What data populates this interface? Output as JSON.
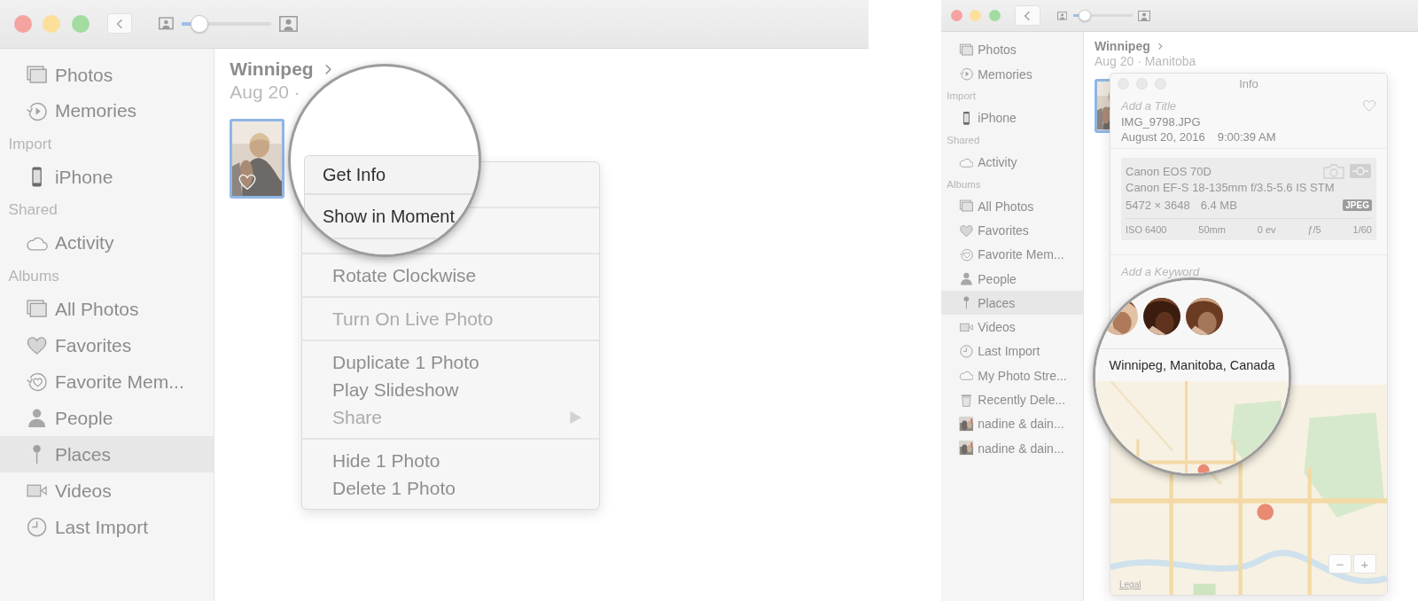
{
  "windows": [
    {
      "toolbar": {
        "zoom_slider": {
          "level": 0.2
        }
      },
      "sidebar": {
        "sections": [
          {
            "items": [
              {
                "label": "Photos",
                "kind": "photos",
                "selected": false
              },
              {
                "label": "Memories",
                "kind": "memories",
                "selected": false
              }
            ]
          },
          {
            "heading": "Import",
            "items": [
              {
                "label": "iPhone",
                "kind": "phone",
                "selected": false
              }
            ]
          },
          {
            "heading": "Shared",
            "items": [
              {
                "label": "Activity",
                "kind": "cloud",
                "selected": false
              }
            ]
          },
          {
            "heading": "Albums",
            "items": [
              {
                "label": "All Photos",
                "kind": "photos",
                "selected": false
              },
              {
                "label": "Favorites",
                "kind": "heart",
                "selected": false
              },
              {
                "label": "Favorite Mem...",
                "kind": "heart-memories",
                "selected": false
              },
              {
                "label": "People",
                "kind": "person",
                "selected": false
              },
              {
                "label": "Places",
                "kind": "pin",
                "selected": true
              },
              {
                "label": "Videos",
                "kind": "video",
                "selected": false
              },
              {
                "label": "Last Import",
                "kind": "clock",
                "selected": false
              }
            ]
          }
        ]
      },
      "content": {
        "title": "Winnipeg",
        "subtitle": "Aug 20 ·",
        "thumbnails": [
          {
            "kind": "picture",
            "selected": true,
            "favorite": true
          }
        ]
      },
      "context_menu": {
        "groups": [
          {
            "items": [
              {
                "label": "Rotate Clockwise",
                "disabled": false,
                "submenu": false
              }
            ]
          },
          {
            "items": [
              {
                "label": "Turn On Live Photo",
                "disabled": true,
                "submenu": false
              }
            ]
          },
          {
            "items": [
              {
                "label": "Duplicate 1 Photo",
                "disabled": false,
                "submenu": false
              },
              {
                "label": "Play Slideshow",
                "disabled": false,
                "submenu": false
              },
              {
                "label": "Share",
                "disabled": true,
                "submenu": true
              }
            ]
          },
          {
            "items": [
              {
                "label": "Hide 1 Photo",
                "disabled": false,
                "submenu": false
              },
              {
                "label": "Delete 1 Photo",
                "disabled": false,
                "submenu": false
              }
            ]
          }
        ]
      },
      "magnifier": {
        "kind": "menu",
        "items": [
          {
            "label": "Get Info"
          },
          {
            "label": "Show in Moment"
          }
        ]
      }
    },
    {
      "toolbar": {
        "zoom_slider": {
          "level": 0.2
        }
      },
      "sidebar": {
        "sections": [
          {
            "items": [
              {
                "label": "Photos",
                "kind": "photos",
                "selected": false
              },
              {
                "label": "Memories",
                "kind": "memories",
                "selected": false
              }
            ]
          },
          {
            "heading": "Import",
            "items": [
              {
                "label": "iPhone",
                "kind": "phone",
                "selected": false
              }
            ]
          },
          {
            "heading": "Shared",
            "items": [
              {
                "label": "Activity",
                "kind": "cloud",
                "selected": false
              }
            ]
          },
          {
            "heading": "Albums",
            "items": [
              {
                "label": "All Photos",
                "kind": "photos",
                "selected": false
              },
              {
                "label": "Favorites",
                "kind": "heart",
                "selected": false
              },
              {
                "label": "Favorite Mem...",
                "kind": "heart-memories",
                "selected": false
              },
              {
                "label": "People",
                "kind": "person",
                "selected": false
              },
              {
                "label": "Places",
                "kind": "pin",
                "selected": true
              },
              {
                "label": "Videos",
                "kind": "video",
                "selected": false
              },
              {
                "label": "Last Import",
                "kind": "clock",
                "selected": false
              },
              {
                "label": "My Photo Stre...",
                "kind": "cloud",
                "selected": false
              },
              {
                "label": "Recently Dele...",
                "kind": "trash",
                "selected": false
              },
              {
                "label": "nadine & dain...",
                "kind": "album",
                "selected": false
              },
              {
                "label": "nadine & dain...",
                "kind": "album",
                "selected": false
              }
            ]
          }
        ]
      },
      "content": {
        "title": "Winnipeg",
        "subtitle": "Aug 20 · Manitoba",
        "thumbnails": [
          {
            "kind": "picture",
            "selected": true,
            "favorite": false
          }
        ]
      },
      "info_panel": {
        "title": "Info",
        "title_placeholder": "Add a Title",
        "filename": "IMG_9798.JPG",
        "date": "August 20, 2016",
        "time": "9:00:39 AM",
        "favorite": false,
        "camera": "Canon EOS 70D",
        "lens": "Canon EF-S 18-135mm f/3.5-5.6 IS STM",
        "dimensions": "5472 × 3648",
        "file_size": "6.4 MB",
        "format": "JPEG",
        "exposure": [
          "ISO 6400",
          "50mm",
          "0 ev",
          "ƒ/5",
          "1/60"
        ],
        "keyword_placeholder": "Add a Keyword",
        "map": {
          "legal": "Legal",
          "zoom_out": "−",
          "zoom_in": "+"
        }
      },
      "magnifier": {
        "kind": "info",
        "faces": [
          {
            "kind": "picture"
          },
          {
            "kind": "picture"
          },
          {
            "kind": "picture"
          }
        ],
        "location": "Winnipeg, Manitoba, Canada"
      }
    }
  ]
}
